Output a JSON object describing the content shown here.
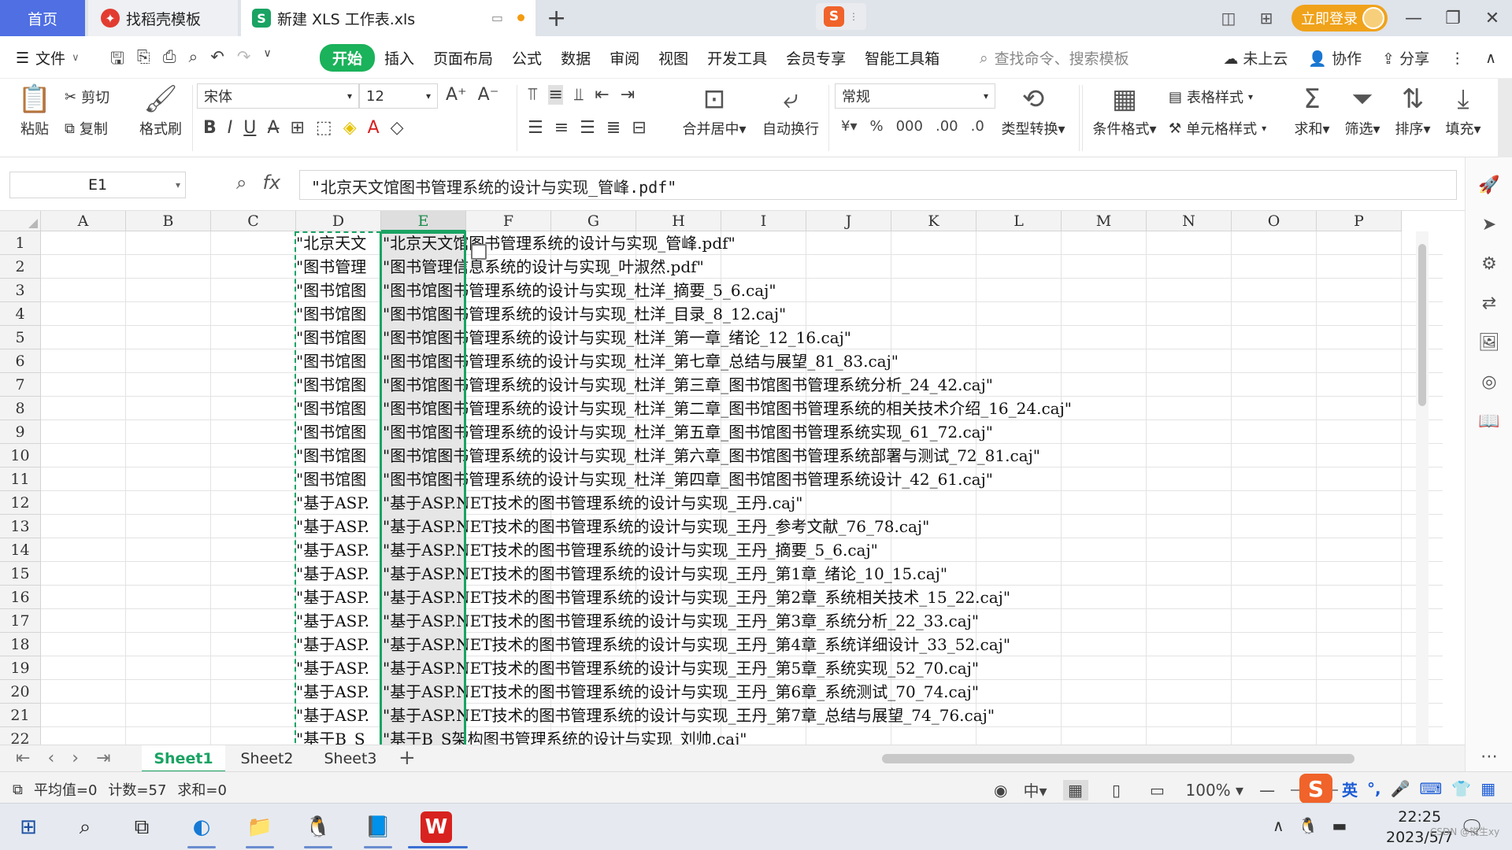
{
  "tabs": {
    "home": "首页",
    "template": "找稻壳模板",
    "file": "新建 XLS 工作表.xls",
    "login": "立即登录"
  },
  "menu": {
    "file": "文件",
    "tabs": [
      "开始",
      "插入",
      "页面布局",
      "公式",
      "数据",
      "审阅",
      "视图",
      "开发工具",
      "会员专享",
      "智能工具箱"
    ],
    "search_placeholder": "查找命令、搜索模板",
    "cloud": "未上云",
    "collab": "协作",
    "share": "分享"
  },
  "ribbon": {
    "paste": "粘贴",
    "cut": "剪切",
    "copy": "复制",
    "format_painter": "格式刷",
    "font_name": "宋体",
    "font_size": "12",
    "merge": "合并居中",
    "wrap": "自动换行",
    "number_format": "常规",
    "type_convert": "类型转换",
    "cond_format": "条件格式",
    "table_style": "表格样式",
    "cell_style": "单元格样式",
    "sum": "求和",
    "filter": "筛选",
    "sort": "排序",
    "fill": "填充"
  },
  "formula": {
    "cell_ref": "E1",
    "content": "\"北京天文馆图书管理系统的设计与实现_管峰.pdf\""
  },
  "columns": [
    "A",
    "B",
    "C",
    "D",
    "E",
    "F",
    "G",
    "H",
    "I",
    "J",
    "K",
    "L",
    "M",
    "N",
    "O",
    "P"
  ],
  "rows": [
    {
      "n": "1",
      "d": "\"北京天文",
      "e": "\"北京天文馆图书管理系统的设计与实现_管峰.pdf\""
    },
    {
      "n": "2",
      "d": "\"图书管理",
      "e": "\"图书管理信息系统的设计与实现_叶淑然.pdf\""
    },
    {
      "n": "3",
      "d": "\"图书馆图",
      "e": "\"图书馆图书管理系统的设计与实现_杜洋_摘要_5_6.caj\""
    },
    {
      "n": "4",
      "d": "\"图书馆图",
      "e": "\"图书馆图书管理系统的设计与实现_杜洋_目录_8_12.caj\""
    },
    {
      "n": "5",
      "d": "\"图书馆图",
      "e": "\"图书馆图书管理系统的设计与实现_杜洋_第一章_绪论_12_16.caj\""
    },
    {
      "n": "6",
      "d": "\"图书馆图",
      "e": "\"图书馆图书管理系统的设计与实现_杜洋_第七章_总结与展望_81_83.caj\""
    },
    {
      "n": "7",
      "d": "\"图书馆图",
      "e": "\"图书馆图书管理系统的设计与实现_杜洋_第三章_图书馆图书管理系统分析_24_42.caj\""
    },
    {
      "n": "8",
      "d": "\"图书馆图",
      "e": "\"图书馆图书管理系统的设计与实现_杜洋_第二章_图书馆图书管理系统的相关技术介绍_16_24.caj\""
    },
    {
      "n": "9",
      "d": "\"图书馆图",
      "e": "\"图书馆图书管理系统的设计与实现_杜洋_第五章_图书馆图书管理系统实现_61_72.caj\""
    },
    {
      "n": "10",
      "d": "\"图书馆图",
      "e": "\"图书馆图书管理系统的设计与实现_杜洋_第六章_图书馆图书管理系统部署与测试_72_81.caj\""
    },
    {
      "n": "11",
      "d": "\"图书馆图",
      "e": "\"图书馆图书管理系统的设计与实现_杜洋_第四章_图书馆图书管理系统设计_42_61.caj\""
    },
    {
      "n": "12",
      "d": "\"基于ASP.",
      "e": "\"基于ASP.NET技术的图书管理系统的设计与实现_王丹.caj\""
    },
    {
      "n": "13",
      "d": "\"基于ASP.",
      "e": "\"基于ASP.NET技术的图书管理系统的设计与实现_王丹_参考文献_76_78.caj\""
    },
    {
      "n": "14",
      "d": "\"基于ASP.",
      "e": "\"基于ASP.NET技术的图书管理系统的设计与实现_王丹_摘要_5_6.caj\""
    },
    {
      "n": "15",
      "d": "\"基于ASP.",
      "e": "\"基于ASP.NET技术的图书管理系统的设计与实现_王丹_第1章_绪论_10_15.caj\""
    },
    {
      "n": "16",
      "d": "\"基于ASP.",
      "e": "\"基于ASP.NET技术的图书管理系统的设计与实现_王丹_第2章_系统相关技术_15_22.caj\""
    },
    {
      "n": "17",
      "d": "\"基于ASP.",
      "e": "\"基于ASP.NET技术的图书管理系统的设计与实现_王丹_第3章_系统分析_22_33.caj\""
    },
    {
      "n": "18",
      "d": "\"基于ASP.",
      "e": "\"基于ASP.NET技术的图书管理系统的设计与实现_王丹_第4章_系统详细设计_33_52.caj\""
    },
    {
      "n": "19",
      "d": "\"基于ASP.",
      "e": "\"基于ASP.NET技术的图书管理系统的设计与实现_王丹_第5章_系统实现_52_70.caj\""
    },
    {
      "n": "20",
      "d": "\"基于ASP.",
      "e": "\"基于ASP.NET技术的图书管理系统的设计与实现_王丹_第6章_系统测试_70_74.caj\""
    },
    {
      "n": "21",
      "d": "\"基于ASP.",
      "e": "\"基于ASP.NET技术的图书管理系统的设计与实现_王丹_第7章_总结与展望_74_76.caj\""
    },
    {
      "n": "22",
      "d": "\"基于B_S",
      "e": "\"基于B_S架构图书管理系统的设计与实现_刘帅.caj\""
    }
  ],
  "sheets": [
    "Sheet1",
    "Sheet2",
    "Sheet3"
  ],
  "status": {
    "average": "平均值=0",
    "count": "计数=57",
    "sum": "求和=0",
    "zoom": "100%",
    "ime_lang": "英"
  },
  "clock": {
    "time": "22:25",
    "date": "2023/5/7"
  },
  "watermark": "CSDN @锐生xy"
}
